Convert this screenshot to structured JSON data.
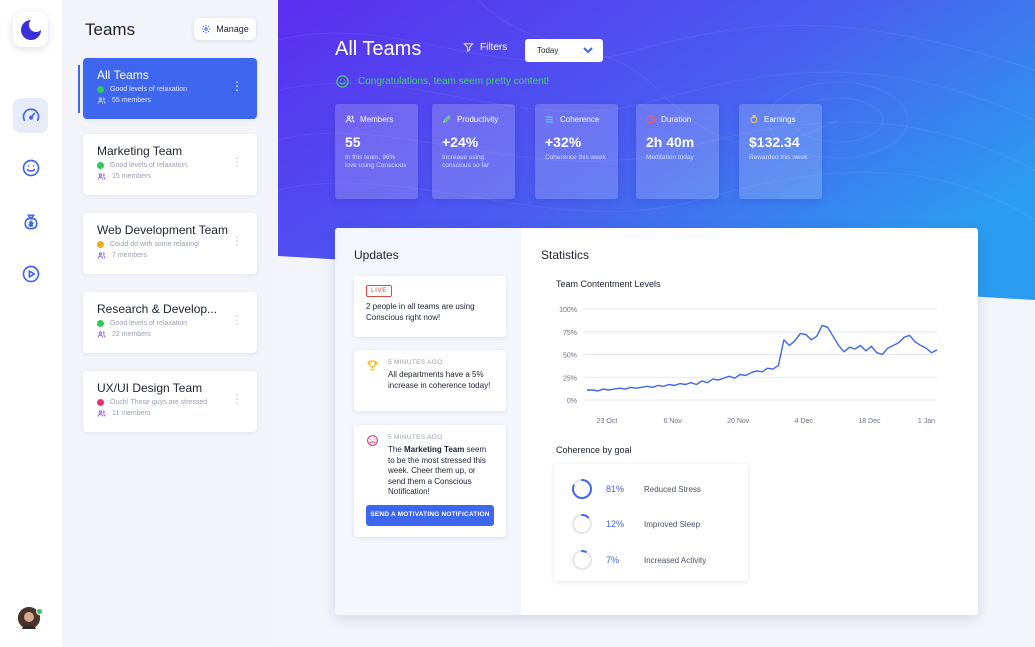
{
  "colors": {
    "accent": "#3f66ee",
    "green": "#2ecc55",
    "orange": "#f5a623",
    "red": "#e8336d",
    "hero_start": "#5b2ef0",
    "hero_end": "#2c9cf0"
  },
  "rail": {
    "icons": [
      "logo-icon",
      "dashboard-gauge-icon",
      "smile-icon",
      "money-bag-icon",
      "play-icon"
    ]
  },
  "teams": {
    "title": "Teams",
    "manage_label": "Manage",
    "items": [
      {
        "name": "All Teams",
        "status": "Good levels of relaxation",
        "status_color": "#2ecc55",
        "members": "55 members"
      },
      {
        "name": "Marketing Team",
        "status": "Good levels of relaxation",
        "status_color": "#2ecc55",
        "members": "15 members"
      },
      {
        "name": "Web Development Team",
        "status": "Could do with some relaxing!",
        "status_color": "#f5a623",
        "members": "7 members"
      },
      {
        "name": "Research & Develop...",
        "status": "Good levels of relaxation",
        "status_color": "#2ecc55",
        "members": "22 members"
      },
      {
        "name": "UX/UI Design Team",
        "status": "Ouch! These guys are stressed",
        "status_color": "#e8336d",
        "members": "11 members"
      }
    ]
  },
  "header": {
    "title": "All Teams",
    "filters_label": "Filters",
    "date_value": "Today",
    "congrats": "Congratulations, team seem pretty content!"
  },
  "stats": [
    {
      "label": "Members",
      "value": "55",
      "sub": "In this team, 96% love using Conscious"
    },
    {
      "label": "Productivity",
      "value": "+24%",
      "sub": "Increase using conscious so far"
    },
    {
      "label": "Coherence",
      "value": "+32%",
      "sub": "Coherence this week"
    },
    {
      "label": "Duration",
      "value": "2h 40m",
      "sub": "Meditation today"
    },
    {
      "label": "Earnings",
      "value": "$132.34",
      "sub": "Rewarded this week"
    }
  ],
  "updates": {
    "title": "Updates",
    "live_label": "LIVE",
    "live_text_bold": "2 people in all teams",
    "live_text_rest": " are using Conscious right now!",
    "item2_time": "5 MINUTES AGO",
    "item2_text_a": "All departments have a ",
    "item2_text_bold": "5% increase in coherence",
    "item2_text_b": " today!",
    "item3_time": "5 MINUTES AGO",
    "item3_text_a": "The ",
    "item3_text_bold": "Marketing Team",
    "item3_text_b": " seem to be the most stressed this week. Cheer them up, or send them a Conscious Notification!",
    "notify_button": "SEND A MOTIVATING NOTIFICATION"
  },
  "statistics": {
    "title": "Statistics",
    "chart_title": "Team Contentment Levels",
    "goal_title": "Coherence by goal",
    "goals": [
      {
        "pct": "81%",
        "value": 0.81,
        "label": "Reduced Stress"
      },
      {
        "pct": "12%",
        "value": 0.12,
        "label": "Improved Sleep"
      },
      {
        "pct": "7%",
        "value": 0.07,
        "label": "Increased Activity"
      }
    ]
  },
  "chart_data": {
    "type": "line",
    "title": "Team Contentment Levels",
    "xlabel": "",
    "ylabel": "",
    "y_ticks": [
      "0%",
      "25%",
      "50%",
      "75%",
      "100%"
    ],
    "x_ticks": [
      "23 Oct",
      "6 Nov",
      "20 Nov",
      "4 Dec",
      "18 Dec",
      "1 Jan"
    ],
    "ylim": [
      0,
      100
    ],
    "grid": true,
    "series": [
      {
        "values": [
          11,
          11,
          10,
          12,
          11,
          12,
          13,
          12,
          14,
          13,
          14,
          15,
          14,
          16,
          15,
          17,
          16,
          18,
          17,
          19,
          17,
          21,
          19,
          23,
          22,
          24,
          26,
          24,
          28,
          27,
          30,
          32,
          31,
          35,
          34,
          38,
          66,
          60,
          65,
          73,
          72,
          66,
          70,
          82,
          80,
          70,
          60,
          53,
          58,
          56,
          60,
          54,
          59,
          52,
          50,
          57,
          60,
          63,
          69,
          71,
          64,
          60,
          57,
          52,
          55
        ]
      }
    ]
  }
}
